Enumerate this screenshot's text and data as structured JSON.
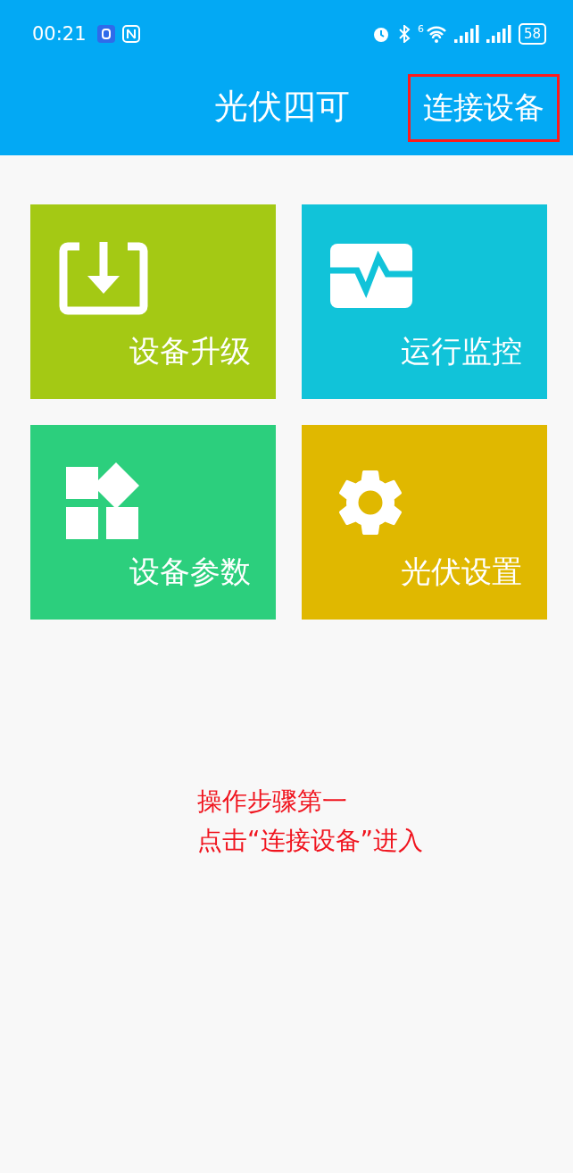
{
  "status_bar": {
    "time": "00:21",
    "wifi_badge": "6",
    "battery": "58"
  },
  "header": {
    "title": "光伏四可",
    "connect_button": {
      "label": "连接设备",
      "highlighted": true
    }
  },
  "tiles": [
    {
      "label": "设备升级",
      "color": "#a4c914"
    },
    {
      "label": "运行监控",
      "color": "#11c3d9"
    },
    {
      "label": "设备参数",
      "color": "#2ccf7d"
    },
    {
      "label": "光伏设置",
      "color": "#e0b800"
    }
  ],
  "annotation": [
    "操作步骤第一",
    "点击“连接设备”进入"
  ]
}
